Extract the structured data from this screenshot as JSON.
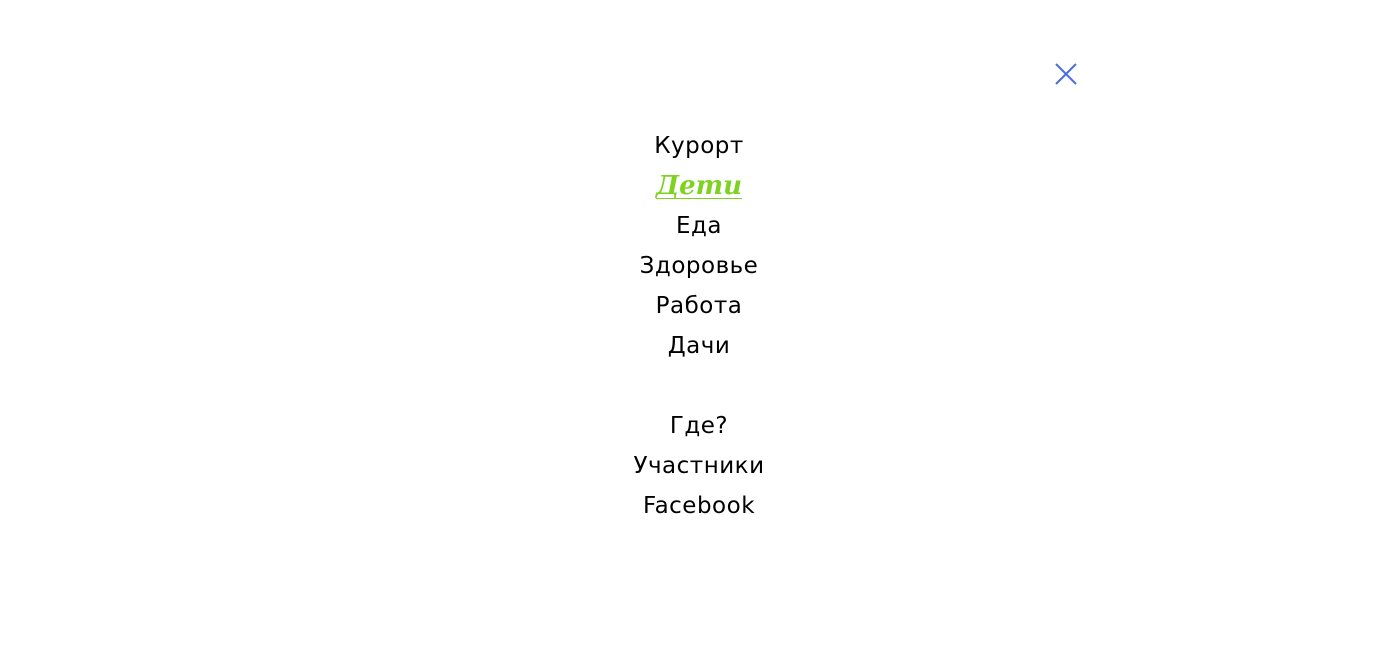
{
  "colors": {
    "background": "#ffffff",
    "text": "#000000",
    "active": "#7ed321",
    "close_icon": "#4a6fe3"
  },
  "close_button": {
    "icon": "close-icon"
  },
  "menu": {
    "items": [
      {
        "label": "Курорт",
        "active": false
      },
      {
        "label": "Дети",
        "active": true
      },
      {
        "label": "Еда",
        "active": false
      },
      {
        "label": "Здоровье",
        "active": false
      },
      {
        "label": "Работа",
        "active": false
      },
      {
        "label": "Дачи",
        "active": false
      }
    ],
    "secondary_items": [
      {
        "label": "Где?"
      },
      {
        "label": "Участники"
      },
      {
        "label": "Facebook"
      }
    ]
  }
}
